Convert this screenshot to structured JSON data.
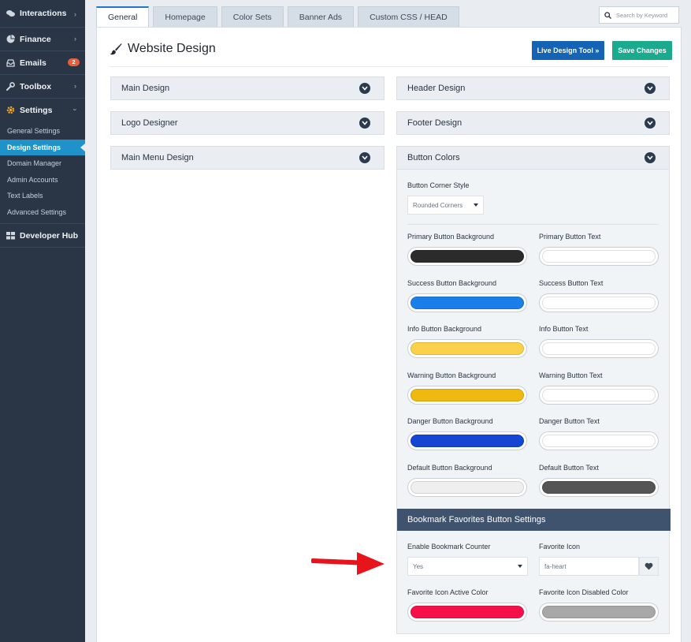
{
  "sidebar": {
    "items": [
      {
        "label": "Interactions"
      },
      {
        "label": "Finance"
      },
      {
        "label": "Emails",
        "badge": "2"
      },
      {
        "label": "Toolbox"
      },
      {
        "label": "Settings"
      }
    ],
    "sub_items": [
      {
        "label": "General Settings"
      },
      {
        "label": "Design Settings"
      },
      {
        "label": "Domain Manager"
      },
      {
        "label": "Admin Accounts"
      },
      {
        "label": "Text Labels"
      },
      {
        "label": "Advanced Settings"
      }
    ],
    "developer": {
      "label": "Developer Hub"
    }
  },
  "tabs": [
    {
      "label": "General"
    },
    {
      "label": "Homepage"
    },
    {
      "label": "Color Sets"
    },
    {
      "label": "Banner Ads"
    },
    {
      "label": "Custom CSS / HEAD"
    }
  ],
  "search": {
    "placeholder": "Search by Keyword"
  },
  "page": {
    "title": "Website Design",
    "live_design_label": "Live Design Tool »",
    "save_label": "Save Changes"
  },
  "accordions": {
    "main_design": "Main Design",
    "logo_designer": "Logo Designer",
    "main_menu_design": "Main Menu Design",
    "header_design": "Header Design",
    "footer_design": "Footer Design",
    "button_colors": "Button Colors"
  },
  "button_colors": {
    "corner_style_label": "Button Corner Style",
    "corner_style_value": "Rounded Corners",
    "fields": [
      {
        "bg_label": "Primary Button Background",
        "bg_color": "#2b2b2b",
        "text_label": "Primary Button Text",
        "text_color": "#ffffff"
      },
      {
        "bg_label": "Success Button Background",
        "bg_color": "#1a7fe8",
        "text_label": "Success Button Text",
        "text_color": "#ffffff"
      },
      {
        "bg_label": "Info Button Background",
        "bg_color": "#fbd14b",
        "text_label": "Info Button Text",
        "text_color": "#ffffff"
      },
      {
        "bg_label": "Warning Button Background",
        "bg_color": "#f0b90f",
        "text_label": "Warning Button Text",
        "text_color": "#ffffff"
      },
      {
        "bg_label": "Danger Button Background",
        "bg_color": "#1446d3",
        "text_label": "Danger Button Text",
        "text_color": "#ffffff"
      },
      {
        "bg_label": "Default Button Background",
        "bg_color": "#efefef",
        "text_label": "Default Button Text",
        "text_color": "#555555"
      }
    ]
  },
  "bookmark": {
    "header": "Bookmark Favorites Button Settings",
    "counter_label": "Enable Bookmark Counter",
    "counter_value": "Yes",
    "icon_label": "Favorite Icon",
    "icon_value": "fa-heart",
    "active_color_label": "Favorite Icon Active Color",
    "active_color": "#f5104a",
    "disabled_color_label": "Favorite Icon Disabled Color",
    "disabled_color": "#a8a8a8"
  },
  "colors": {
    "sidebar_bg": "#2a3546",
    "active_nav": "#1f93c9",
    "live_design": "#1463b4",
    "save": "#1aab8f",
    "annotation_arrow": "#e8141c"
  }
}
